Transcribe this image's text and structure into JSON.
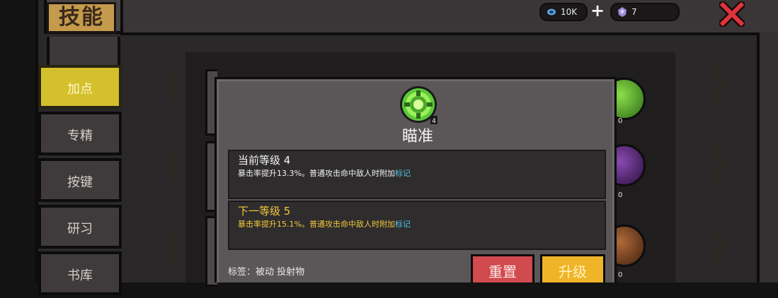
{
  "header": {
    "title": "技能",
    "gems_value": "10K",
    "gems_icon": "gem-icon",
    "materials_value": "7",
    "materials_icon": "crystal-icon",
    "plus_icon": "plus-icon",
    "close_icon": "close-x-icon"
  },
  "sidebar": {
    "items": [
      {
        "label": "加点",
        "active": true
      },
      {
        "label": "专精",
        "active": false
      },
      {
        "label": "按键",
        "active": false
      },
      {
        "label": "研习",
        "active": false
      },
      {
        "label": "书库",
        "active": false
      }
    ]
  },
  "skill_grid": {
    "visible_level_digits": [
      "0",
      "0",
      "0"
    ]
  },
  "skill_detail": {
    "name": "瞄准",
    "icon": "aim-target-icon",
    "icon_badge": "4",
    "current_level": {
      "label": "当前等级 4",
      "description_prefix": "暴击率提升13.3%。普通攻击命中敌人时附加",
      "description_mark": "标记"
    },
    "next_level": {
      "label": "下一等级 5",
      "description_prefix": "暴击率提升15.1%。普通攻击命中敌人时附加",
      "description_mark": "标记"
    },
    "tags_label": "标签：被动 投射物",
    "reset_label": "重置",
    "upgrade_label": "升级"
  },
  "colors": {
    "active_tab": "#d4c02c",
    "title_plate": "#c49a4c",
    "current_level_text": "#f2f2f2",
    "next_level_text": "#f0c83c",
    "mark_text": "#4fc8e8",
    "reset_button": "#d04a4e",
    "upgrade_button": "#f0b428"
  }
}
